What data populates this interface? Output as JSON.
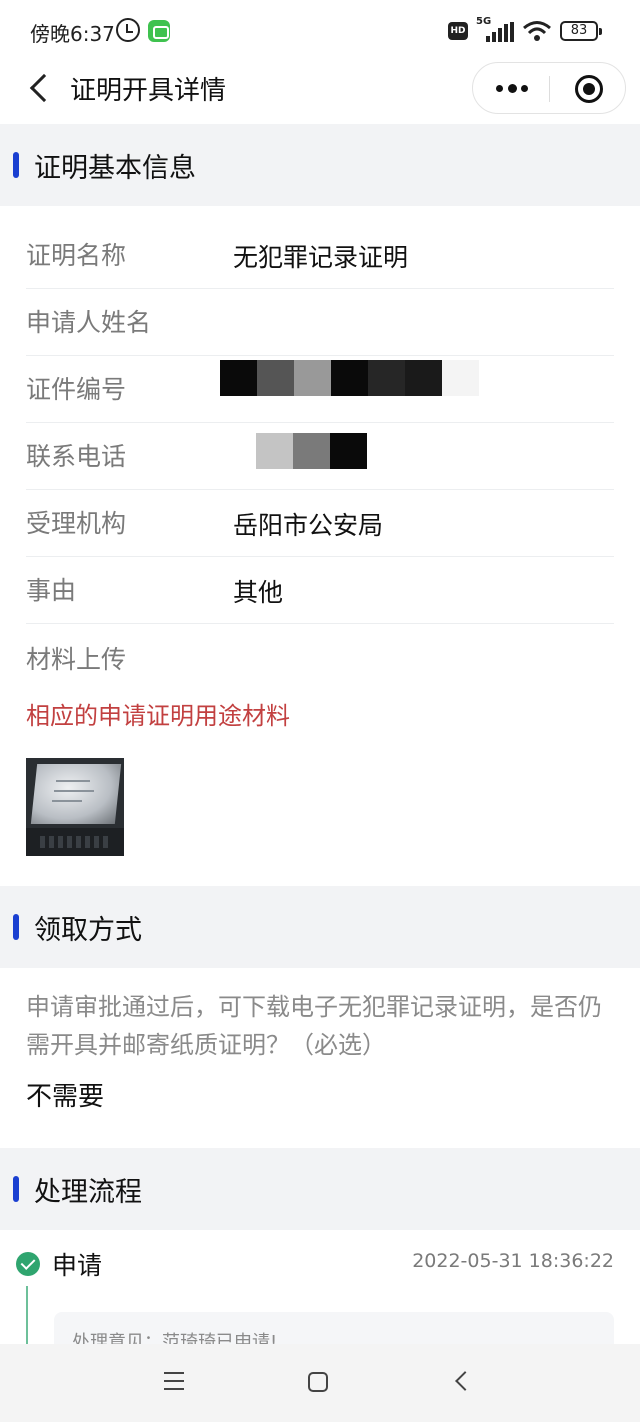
{
  "status": {
    "time": "傍晚6:37",
    "hd": "HD",
    "network": "5G",
    "battery": "83",
    "icons": [
      "alarm-icon",
      "app-notification-icon",
      "signal-icon",
      "wifi-icon",
      "battery-icon"
    ]
  },
  "nav": {
    "title": "证明开具详情",
    "icons": [
      "back-icon",
      "more-icon",
      "close-target-icon"
    ]
  },
  "basic": {
    "section_title": "证明基本信息",
    "rows": [
      {
        "label": "证明名称",
        "value": "无犯罪记录证明"
      },
      {
        "label": "申请人姓名",
        "value": ""
      },
      {
        "label": "证件编号",
        "value": ""
      },
      {
        "label": "联系电话",
        "value": ""
      },
      {
        "label": "受理机构",
        "value": "岳阳市公安局"
      },
      {
        "label": "事由",
        "value": "其他"
      }
    ],
    "material_label": "材料上传",
    "material_note": "相应的申请证明用途材料"
  },
  "pickup": {
    "section_title": "领取方式",
    "question": "申请审批通过后，可下载电子无犯罪记录证明，是否仍需开具并邮寄纸质证明？（必选）",
    "answer": "不需要"
  },
  "flow": {
    "section_title": "处理流程",
    "steps": [
      {
        "name": "申请",
        "time": "2022-05-31 18:36:22",
        "comment": "处理意见：范琦琦已申请!"
      }
    ]
  },
  "colors": {
    "accent": "#1a3fd1",
    "success": "#2fa56f",
    "warning_text": "#c24040"
  }
}
